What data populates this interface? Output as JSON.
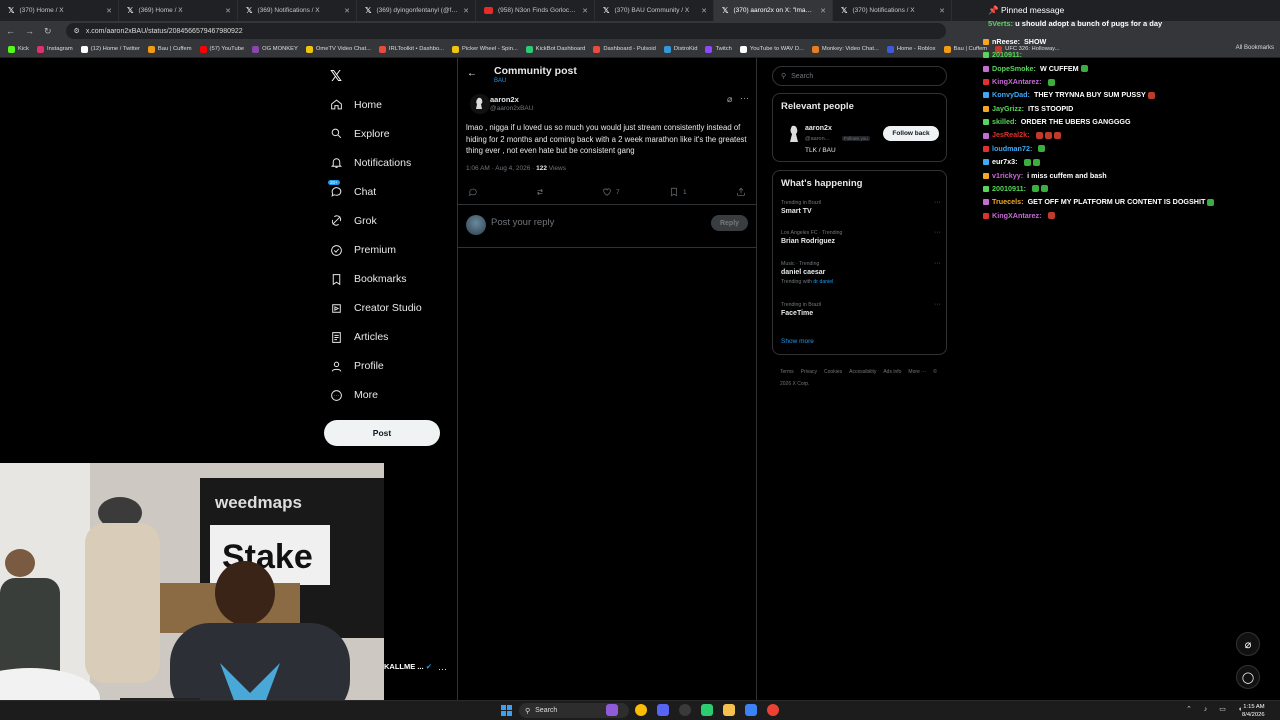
{
  "browser": {
    "tabs": [
      {
        "label": "(370) Home / X",
        "active": false
      },
      {
        "label": "(369) Home / X",
        "active": false
      },
      {
        "label": "(369) Notifications / X",
        "active": false
      },
      {
        "label": "(369) dyingonfentanyl (@fenta",
        "active": false
      },
      {
        "label": "(958) N3on Finds Gorlock Love",
        "active": false
      },
      {
        "label": "(370) BAU Community / X",
        "active": false
      },
      {
        "label": "(370) aaron2x on X: \"lmao , nig",
        "active": true
      },
      {
        "label": "(370) Notifications / X",
        "active": false
      }
    ],
    "url": "x.com/aaron2xBAU/status/2084566579467980922",
    "bookmarks": [
      "Kick",
      "Instagram",
      "(12) Home / Twitter",
      "Bau | Cuffem",
      "(57) YouTube",
      "OG MONKEY",
      "OmeTV Video Chat...",
      "IRLToolkit • Dashbo...",
      "Picker Wheel - Spin...",
      "KickBot Dashboard",
      "Dashboard - Pulsoid",
      "DistroKid",
      "Twitch",
      "YouTube to WAV D...",
      "Monkey: Video Chat...",
      "Home - Roblox",
      "Bau | Cuffem",
      "UFC 326: Holloway..."
    ],
    "all_bookmarks": "All Bookmarks"
  },
  "nav": {
    "items": [
      {
        "label": "Home",
        "icon": "home-icon"
      },
      {
        "label": "Explore",
        "icon": "search-icon"
      },
      {
        "label": "Notifications",
        "icon": "bell-icon"
      },
      {
        "label": "Chat",
        "icon": "chat-icon"
      },
      {
        "label": "Grok",
        "icon": "grok-icon"
      },
      {
        "label": "Premium",
        "icon": "x-premium-icon"
      },
      {
        "label": "Bookmarks",
        "icon": "bookmark-icon"
      },
      {
        "label": "Creator Studio",
        "icon": "creator-studio-icon"
      },
      {
        "label": "Articles",
        "icon": "article-icon"
      },
      {
        "label": "Profile",
        "icon": "person-icon"
      },
      {
        "label": "More",
        "icon": "more-circle-icon"
      }
    ],
    "chat_badge": "20+",
    "post_label": "Post"
  },
  "post": {
    "header_title": "Community post",
    "header_sub": "BAU",
    "author_name": "aaron2x",
    "author_handle": "@aaron2xBAU",
    "text": "lmao , nigga if u loved us so much you would just stream consistently instead of hiding for 2 months and coming back with a 2 week marathon like it's the greatest thing ever , not even hate but be consistent gang",
    "time": "1:06 AM · Aug 4, 2026 · ",
    "views_count": "122",
    "views_label": " Views",
    "likes": "7",
    "bookmarks": "1",
    "reply_placeholder": "Post your reply",
    "reply_button": "Reply"
  },
  "right": {
    "search_placeholder": "Search",
    "relevant_title": "Relevant people",
    "relevant_name": "aaron2x",
    "relevant_handle": "@aaron...",
    "relevant_follows": "Follows you",
    "relevant_bio": "TLK / BAU",
    "follow_button": "Follow back",
    "happening_title": "What's happening",
    "trends": [
      {
        "context": "Trending in Brazil",
        "name": "Smart TV",
        "with_label": "",
        "with_link": ""
      },
      {
        "context": "Los Angeles FC · Trending",
        "name": "Brian Rodriguez",
        "with_label": "",
        "with_link": ""
      },
      {
        "context": "Music · Trending",
        "name": "daniel caesar",
        "with_label": "Trending with ",
        "with_link": "dr daniel"
      },
      {
        "context": "Trending in Brazil",
        "name": "FaceTime",
        "with_label": "",
        "with_link": ""
      }
    ],
    "show_more": "Show more",
    "footer": [
      "Terms",
      "Privacy",
      "Cookies",
      "Accessibility",
      "Ads info",
      "More ···",
      "© 2026 X Corp."
    ]
  },
  "chat": {
    "pinned_label": "Pinned message",
    "pinned_user": "5Verts:",
    "pinned_text": " u should adopt a bunch of pugs for a day",
    "messages": [
      {
        "user": "nReese:",
        "color": "#ffffff",
        "text": "SHOW",
        "emotes": 0
      },
      {
        "user": "2010911:",
        "color": "#57d65a",
        "text": "",
        "emotes": 0
      },
      {
        "user": "DopeSmoke:",
        "color": "#57d65a",
        "text": "W CUFFEM",
        "emotes": 1
      },
      {
        "user": "KingXAntarez:",
        "color": "#c76bd6",
        "text": "",
        "emotes": 1
      },
      {
        "user": "KonvyDad:",
        "color": "#3fa9f5",
        "text": "THEY TRYNNA BUY SUM PUSSY",
        "emotes": 1
      },
      {
        "user": "JayGrizz:",
        "color": "#57d65a",
        "text": "ITS STOOPID",
        "emotes": 0
      },
      {
        "user": "skilled:",
        "color": "#57d65a",
        "text": "ORDER THE UBERS GANGGGG",
        "emotes": 0
      },
      {
        "user": "JesReal2k:",
        "color": "#e0322b",
        "text": "",
        "emotes": 3
      },
      {
        "user": "loudman72:",
        "color": "#3fa9f5",
        "text": "",
        "emotes": 1
      },
      {
        "user": "eur7x3:",
        "color": "#ffffff",
        "text": "",
        "emotes": 2
      },
      {
        "user": "v1rickyy:",
        "color": "#c76bd6",
        "text": "i miss cuffem and bash",
        "emotes": 0
      },
      {
        "user": "20010911:",
        "color": "#57d65a",
        "text": "",
        "emotes": 2
      },
      {
        "user": "Truecels:",
        "color": "#f5a623",
        "text": "GET OFF MY PLATFORM UR CONTENT IS DOGSHIT",
        "emotes": 1
      },
      {
        "user": "KingXAntarez:",
        "color": "#c76bd6",
        "text": "",
        "emotes": 1
      }
    ]
  },
  "webcam": {
    "banner_top": "weedmaps",
    "banner_main": "Stake",
    "account_name": "KALLME ..."
  },
  "taskbar": {
    "search": "Search",
    "time": "1:15 AM",
    "date": "8/4/2026"
  }
}
